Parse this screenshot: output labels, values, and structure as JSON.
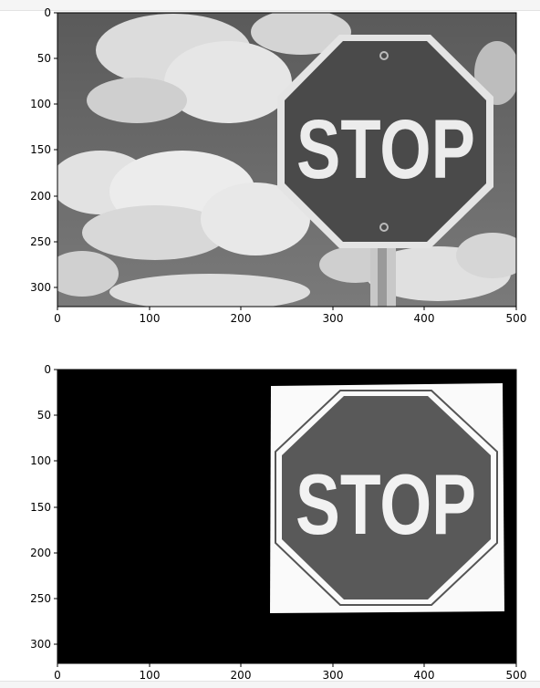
{
  "plots": [
    {
      "name": "original-image",
      "x_ticks": [
        "0",
        "100",
        "200",
        "300",
        "400",
        "500"
      ],
      "y_ticks": [
        "0",
        "50",
        "100",
        "150",
        "200",
        "250",
        "300"
      ],
      "sign_text": "STOP"
    },
    {
      "name": "warped-image",
      "x_ticks": [
        "0",
        "100",
        "200",
        "300",
        "400",
        "500"
      ],
      "y_ticks": [
        "0",
        "50",
        "100",
        "150",
        "200",
        "250",
        "300"
      ],
      "sign_text": "STOP"
    }
  ],
  "colors": {
    "background": "#ffffff",
    "axis": "#000000",
    "black_fill": "#000000",
    "sign_face": "#555555",
    "sign_text": "#e8e8e8",
    "sky": "#6e6e6e",
    "cloud": "#e6e6e6"
  }
}
